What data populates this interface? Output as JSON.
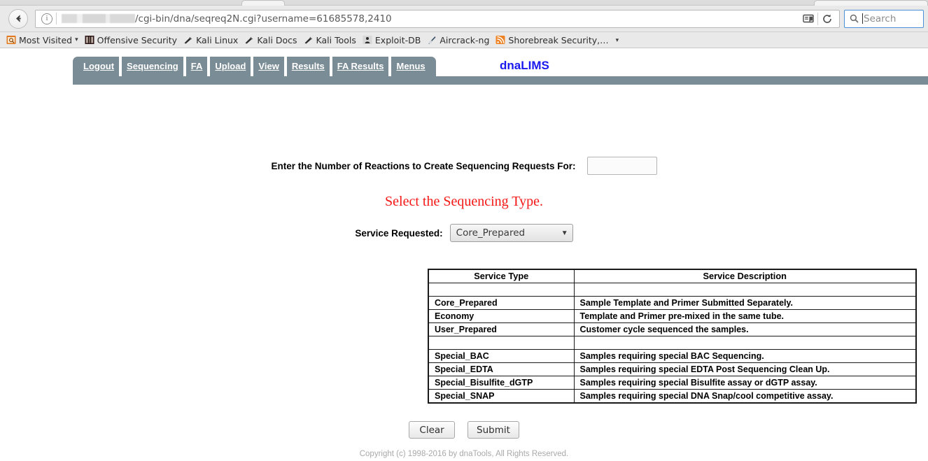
{
  "browser": {
    "back_icon": "back-arrow-icon",
    "info_icon": "info-icon",
    "url_text": "/cgi-bin/dna/seqreq2N.cgi?username=61685578,2410",
    "url_redacted_note": "host-redacted",
    "reader_icon": "reader-view-icon",
    "reload_icon": "reload-icon",
    "search_icon": "search-icon",
    "search_placeholder": "Search",
    "search_value": "",
    "bookmarks": [
      {
        "label": "Most Visited",
        "icon": "most-visited-icon",
        "caret": "▾"
      },
      {
        "label": "Offensive Security",
        "icon": "offensive-security-icon",
        "caret": ""
      },
      {
        "label": "Kali Linux",
        "icon": "kali-linux-icon",
        "caret": ""
      },
      {
        "label": "Kali Docs",
        "icon": "kali-docs-icon",
        "caret": ""
      },
      {
        "label": "Kali Tools",
        "icon": "kali-tools-icon",
        "caret": ""
      },
      {
        "label": "Exploit-DB",
        "icon": "exploit-db-icon",
        "caret": ""
      },
      {
        "label": "Aircrack-ng",
        "icon": "aircrack-ng-icon",
        "caret": ""
      },
      {
        "label": "Shorebreak Security,…",
        "icon": "rss-feed-icon",
        "caret": ""
      }
    ],
    "bookmarks_overflow_caret": "▾"
  },
  "app": {
    "brand": "dnaLIMS",
    "brand_color": "#1a1aee",
    "navbar_color": "#7a8c95",
    "tabs": [
      {
        "label": "Logout"
      },
      {
        "label": "Sequencing"
      },
      {
        "label": "FA"
      },
      {
        "label": "Upload"
      },
      {
        "label": "View"
      },
      {
        "label": "Results"
      },
      {
        "label": "FA Results"
      },
      {
        "label": "Menus"
      }
    ]
  },
  "form": {
    "reactions_label": "Enter the Number of Reactions to Create Sequencing Requests For:",
    "reactions_value": "",
    "reactions_placeholder": "",
    "select_prompt": "Select the Sequencing Type.",
    "select_prompt_color": "#f51616",
    "service_label": "Service Requested:",
    "service_value": "Core_Prepared",
    "service_caret": "▼",
    "service_options": [
      "Core_Prepared",
      "Economy",
      "User_Prepared",
      "Special_BAC",
      "Special_EDTA",
      "Special_Bisulfite_dGTP",
      "Special_SNAP"
    ],
    "clear_label": "Clear",
    "submit_label": "Submit"
  },
  "table": {
    "headers": [
      "Service Type",
      "Service Description"
    ],
    "rows": [
      {
        "type": "",
        "description": "",
        "spacer": true
      },
      {
        "type": "Core_Prepared",
        "description": "Sample Template and Primer Submitted Separately."
      },
      {
        "type": "Economy",
        "description": "Template and Primer pre-mixed in the same tube."
      },
      {
        "type": "User_Prepared",
        "description": "Customer cycle sequenced the samples."
      },
      {
        "type": "",
        "description": "",
        "spacer": true
      },
      {
        "type": "Special_BAC",
        "description": "Samples requiring special BAC Sequencing."
      },
      {
        "type": "Special_EDTA",
        "description": "Samples requiring special EDTA Post Sequencing Clean Up."
      },
      {
        "type": "Special_Bisulfite_dGTP",
        "description": "Samples requiring special Bisulfite assay or dGTP assay."
      },
      {
        "type": "Special_SNAP",
        "description": "Samples requiring special DNA Snap/cool competitive assay."
      }
    ]
  },
  "footer": {
    "copyright": "Copyright (c) 1998-2016 by dnaTools, All Rights Reserved."
  }
}
